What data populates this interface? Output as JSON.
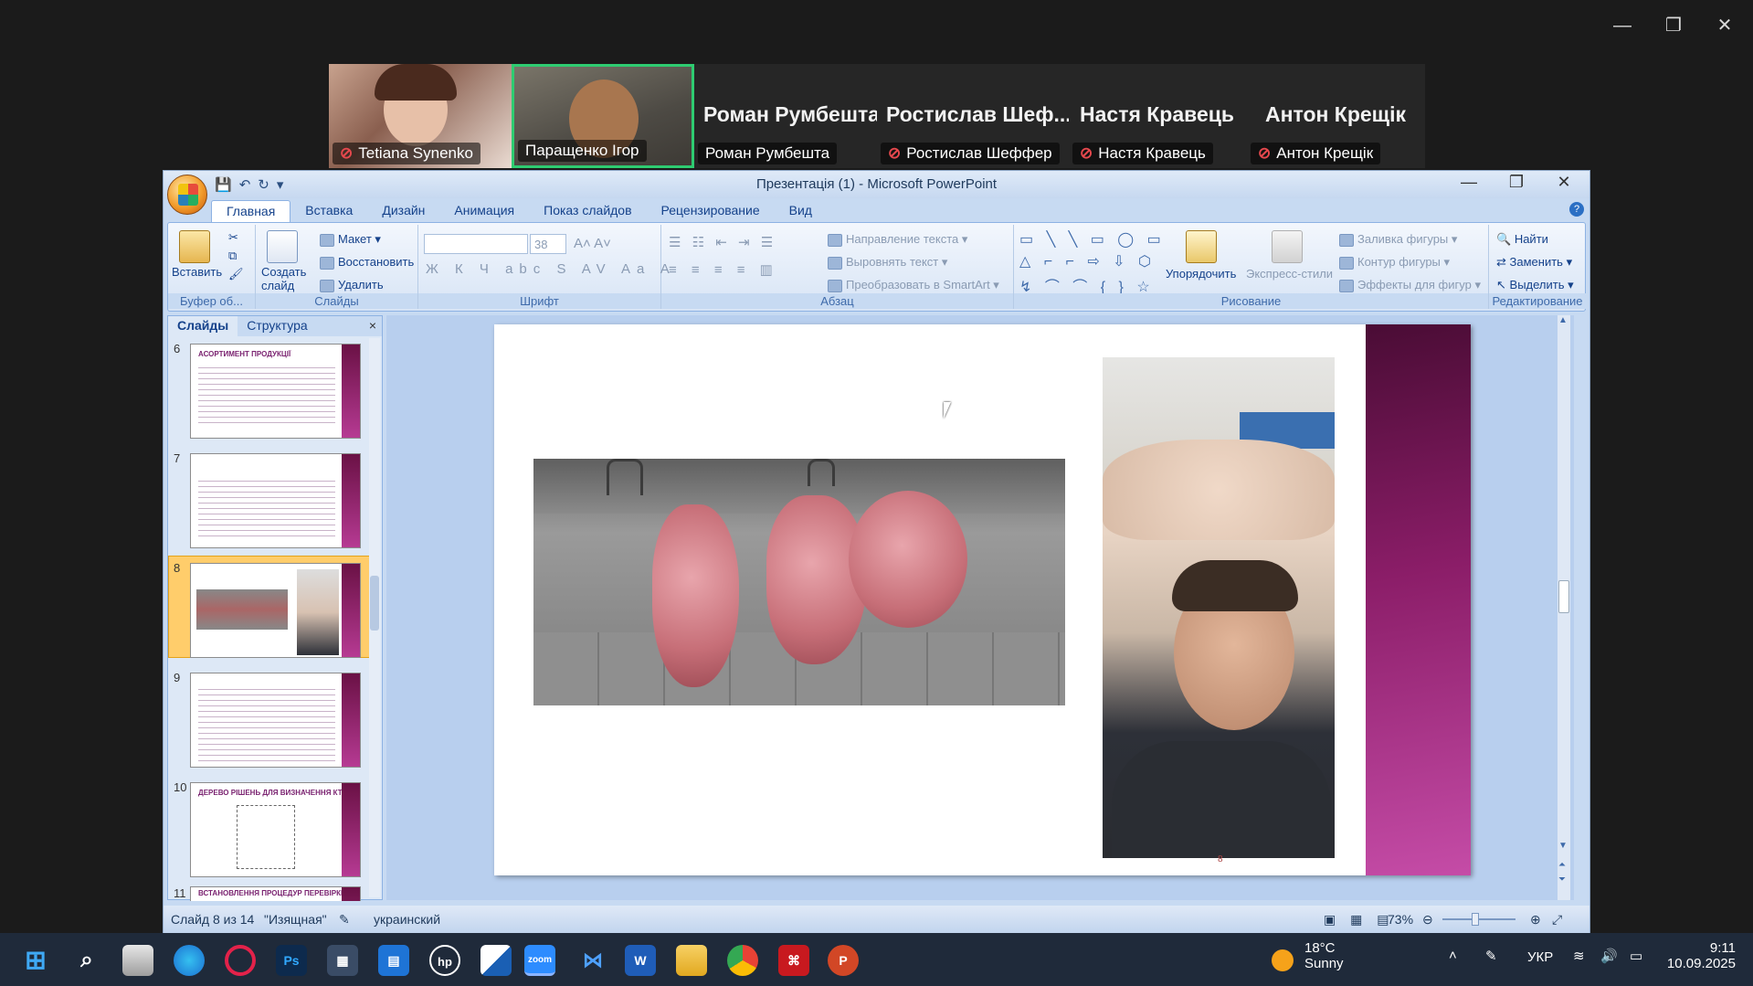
{
  "window": {
    "minimize": "—",
    "restore": "❐",
    "close": "✕"
  },
  "participants": [
    {
      "name": "Tetiana Synenko",
      "muted": true
    },
    {
      "name": "Паращенко Ігор",
      "muted": false
    },
    {
      "name": "Роман Румбешта",
      "display_name": "Роман Румбешта",
      "muted": false
    },
    {
      "name": "Ростислав Шеффер",
      "display_name": "Ростислав Шеф...",
      "muted": true
    },
    {
      "name": "Настя Кравець",
      "display_name": "Настя Кравець",
      "muted": true
    },
    {
      "name": "Антон Крещік",
      "display_name": "Антон Крещік",
      "muted": true
    }
  ],
  "ppt": {
    "title": "Презентація (1) - Microsoft PowerPoint",
    "tabs": [
      "Главная",
      "Вставка",
      "Дизайн",
      "Анимация",
      "Показ слайдов",
      "Рецензирование",
      "Вид"
    ],
    "ribbon": {
      "paste": "Вставить",
      "buffer": "Буфер об...",
      "create_slide": "Создать слайд",
      "layout": "Макет",
      "restore": "Восстановить",
      "delete": "Удалить",
      "slides_group": "Слайды",
      "font_size": "38",
      "font_group": "Шрифт",
      "text_direction": "Направление текста",
      "align_text": "Выровнять текст",
      "smartart": "Преобразовать в SmartArt",
      "paragraph_group": "Абзац",
      "arrange": "Упорядочить",
      "quick_styles": "Экспресс-стили",
      "shape_fill": "Заливка фигуры",
      "shape_outline": "Контур фигуры",
      "shape_effects": "Эффекты для фигур",
      "drawing_group": "Рисование",
      "find": "Найти",
      "replace": "Заменить",
      "select": "Выделить",
      "editing_group": "Редактирование"
    },
    "panel_tabs": [
      "Слайды",
      "Структура"
    ],
    "thumbnails": [
      {
        "num": "6",
        "title": "АСОРТИМЕНТ ПРОДУКЦІЇ"
      },
      {
        "num": "7",
        "title": ""
      },
      {
        "num": "8",
        "title": ""
      },
      {
        "num": "9",
        "title": ""
      },
      {
        "num": "10",
        "title": "ДЕРЕВО РІШЕНЬ ДЛЯ ВИЗНАЧЕННЯ КТ"
      },
      {
        "num": "11",
        "title": "ВСТАНОВЛЕННЯ ПРОЦЕДУР ПЕРЕВІРКИ ТА"
      }
    ],
    "slide_number": "8",
    "status": {
      "slide": "Слайд 8 из 14",
      "theme": "\"Изящная\"",
      "language": "украинский",
      "zoom": "73%"
    }
  },
  "taskbar": {
    "weather_temp": "18°C",
    "weather_desc": "Sunny",
    "lang": "УКР",
    "time": "9:11",
    "date": "10.09.2025"
  }
}
